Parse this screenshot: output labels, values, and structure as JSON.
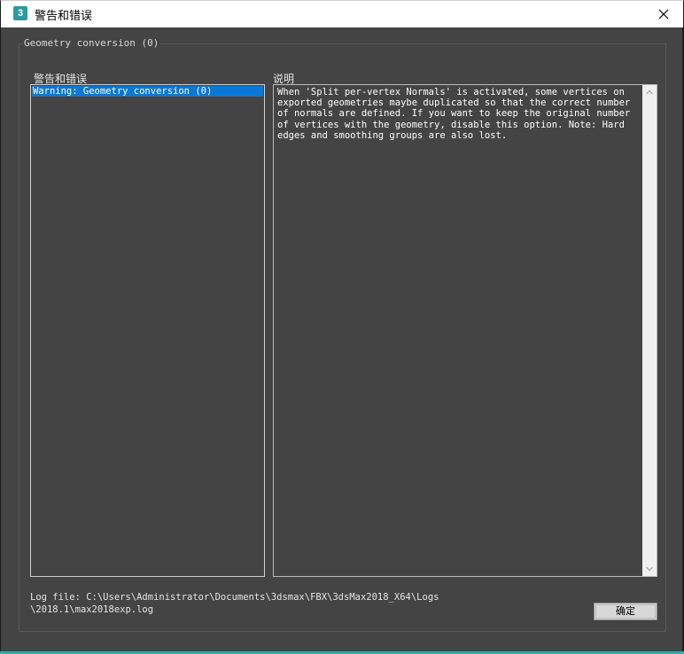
{
  "window": {
    "title": "警告和错误",
    "app_icon_glyph": "3",
    "app_icon_color": "#2e9aa0"
  },
  "group": {
    "label": "Geometry conversion (0)"
  },
  "warnings_pane": {
    "label": "警告和错误",
    "items": [
      "Warning: Geometry conversion (0)"
    ],
    "selected_color": "#0a78d7"
  },
  "description_pane": {
    "label": "说明",
    "text": "When 'Split per-vertex Normals' is activated, some vertices on exported geometries maybe duplicated so that the correct number of normals are defined. If you want to keep the original number of vertices with the geometry, disable this option. Note: Hard edges and smoothing groups are also lost."
  },
  "log": {
    "line1": "Log file: C:\\Users\\Administrator\\Documents\\3dsmax\\FBX\\3dsMax2018_X64\\Logs",
    "line2": "\\2018.1\\max2018exp.log"
  },
  "buttons": {
    "ok_label": "确定"
  },
  "icons": {
    "close": "close-icon",
    "scroll_up": "chevron-up-icon",
    "scroll_down": "chevron-down-icon"
  }
}
